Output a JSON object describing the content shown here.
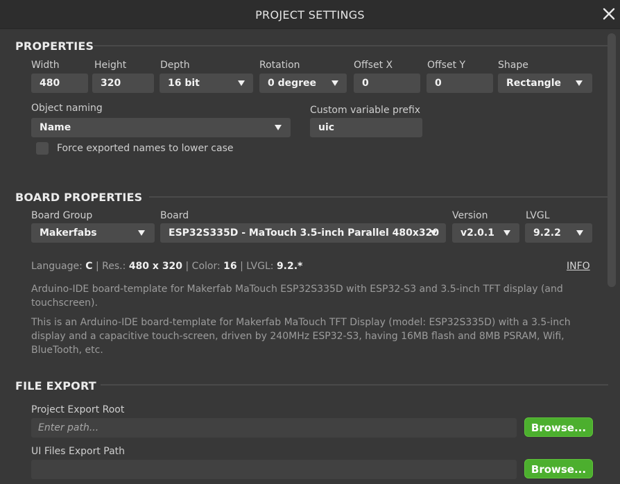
{
  "window": {
    "title": "PROJECT SETTINGS",
    "close_icon": "close-icon"
  },
  "properties": {
    "section_title": "PROPERTIES",
    "width": {
      "label": "Width",
      "value": "480"
    },
    "height": {
      "label": "Height",
      "value": "320"
    },
    "depth": {
      "label": "Depth",
      "value": "16 bit"
    },
    "rotation": {
      "label": "Rotation",
      "value": "0 degree"
    },
    "offset_x": {
      "label": "Offset X",
      "value": "0"
    },
    "offset_y": {
      "label": "Offset Y",
      "value": "0"
    },
    "shape": {
      "label": "Shape",
      "value": "Rectangle"
    },
    "object_naming": {
      "label": "Object naming",
      "value": "Name"
    },
    "custom_prefix": {
      "label": "Custom variable prefix",
      "value": "uic"
    },
    "force_lowercase": {
      "label": "Force exported names to lower case",
      "checked": false
    }
  },
  "board": {
    "section_title": "BOARD PROPERTIES",
    "group": {
      "label": "Board Group",
      "value": "Makerfabs"
    },
    "board": {
      "label": "Board",
      "value": "ESP32S335D - MaTouch 3.5-inch Parallel 480x320"
    },
    "version": {
      "label": "Version",
      "value": "v2.0.1"
    },
    "lvgl": {
      "label": "LVGL",
      "value": "9.2.2"
    },
    "info": {
      "language_label": "Language:",
      "language": "C",
      "res_label": "Res.:",
      "res": "480 x 320",
      "color_label": "Color:",
      "color": "16",
      "lvgl_label": "LVGL:",
      "lvgl": "9.2.*",
      "sep": "|",
      "info_link": "INFO"
    },
    "desc_short": "Arduino-IDE board-template for Makerfab MaTouch ESP32S335D with ESP32-S3 and 3.5-inch TFT display (and touchscreen).",
    "desc_long": "This is an Arduino-IDE board-template for Makerfab MaTouch TFT Display (model: ESP32S335D) with a 3.5-inch display and a capacitive touch-screen, driven by 240MHz ESP32-S3, having 16MB flash and 8MB PSRAM, Wifi, BlueTooth, etc."
  },
  "file_export": {
    "section_title": "FILE EXPORT",
    "project_root": {
      "label": "Project Export Root",
      "placeholder": "Enter path...",
      "button": "Browse..."
    },
    "ui_files": {
      "label": "UI Files Export Path",
      "value": "",
      "button": "Browse..."
    }
  },
  "colors": {
    "accent": "#4caf2e",
    "background": "#383838",
    "titlebar": "#2d2d2d",
    "field": "#4b4b4b"
  }
}
